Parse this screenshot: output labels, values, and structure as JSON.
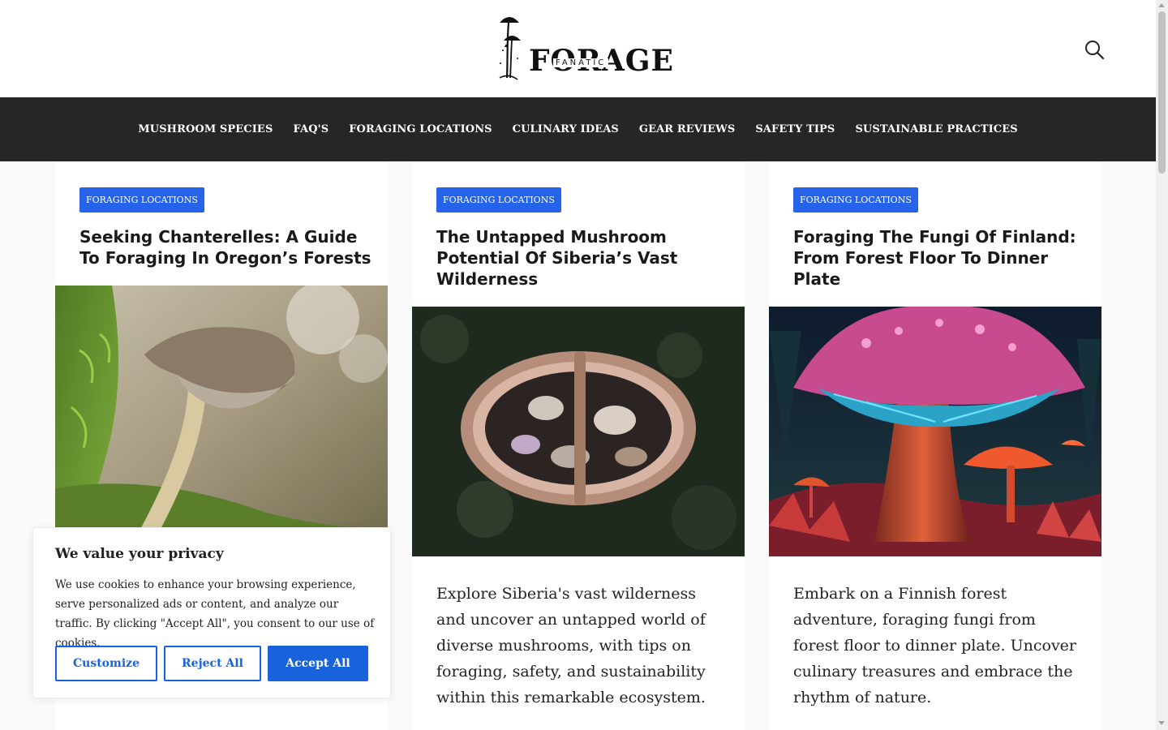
{
  "header": {
    "logo_text": "FORAGE",
    "logo_subtext": "FANATIC",
    "search_icon": "search-icon"
  },
  "nav": {
    "items": [
      {
        "label": "MUSHROOM SPECIES"
      },
      {
        "label": "FAQ'S"
      },
      {
        "label": "FORAGING LOCATIONS"
      },
      {
        "label": "CULINARY IDEAS"
      },
      {
        "label": "GEAR REVIEWS"
      },
      {
        "label": "SAFETY TIPS"
      },
      {
        "label": "SUSTAINABLE PRACTICES"
      }
    ]
  },
  "articles": [
    {
      "category": "FORAGING LOCATIONS",
      "title": "Seeking Chanterelles: A Guide To Foraging In Oregon’s Forests",
      "excerpt": "",
      "image": "mushroom-on-moss-photo"
    },
    {
      "category": "FORAGING LOCATIONS",
      "title": "The Untapped Mushroom Potential Of Siberia’s Vast Wilderness",
      "excerpt": "Explore Siberia's vast wilderness and uncover an untapped world of diverse mushrooms, with tips on foraging, safety, and sustainability within this remarkable ecosystem.",
      "image": "basket-of-mushrooms-photo"
    },
    {
      "category": "FORAGING LOCATIONS",
      "title": "Foraging The Fungi Of Finland: From Forest Floor To Dinner Plate",
      "excerpt": "Embark on a Finnish forest adventure, foraging fungi from forest floor to dinner plate. Uncover culinary treasures and embrace the rhythm of nature.",
      "image": "neon-mushroom-illustration"
    }
  ],
  "cookie_banner": {
    "title": "We value your privacy",
    "text": "We use cookies to enhance your browsing experience, serve personalized ads or content, and analyze our traffic. By clicking \"Accept All\", you consent to our use of cookies.",
    "customize_label": "Customize",
    "reject_label": "Reject All",
    "accept_label": "Accept All"
  },
  "colors": {
    "accent": "#2563eb",
    "nav_background": "#262626",
    "cookie_accent": "#1863dc"
  }
}
